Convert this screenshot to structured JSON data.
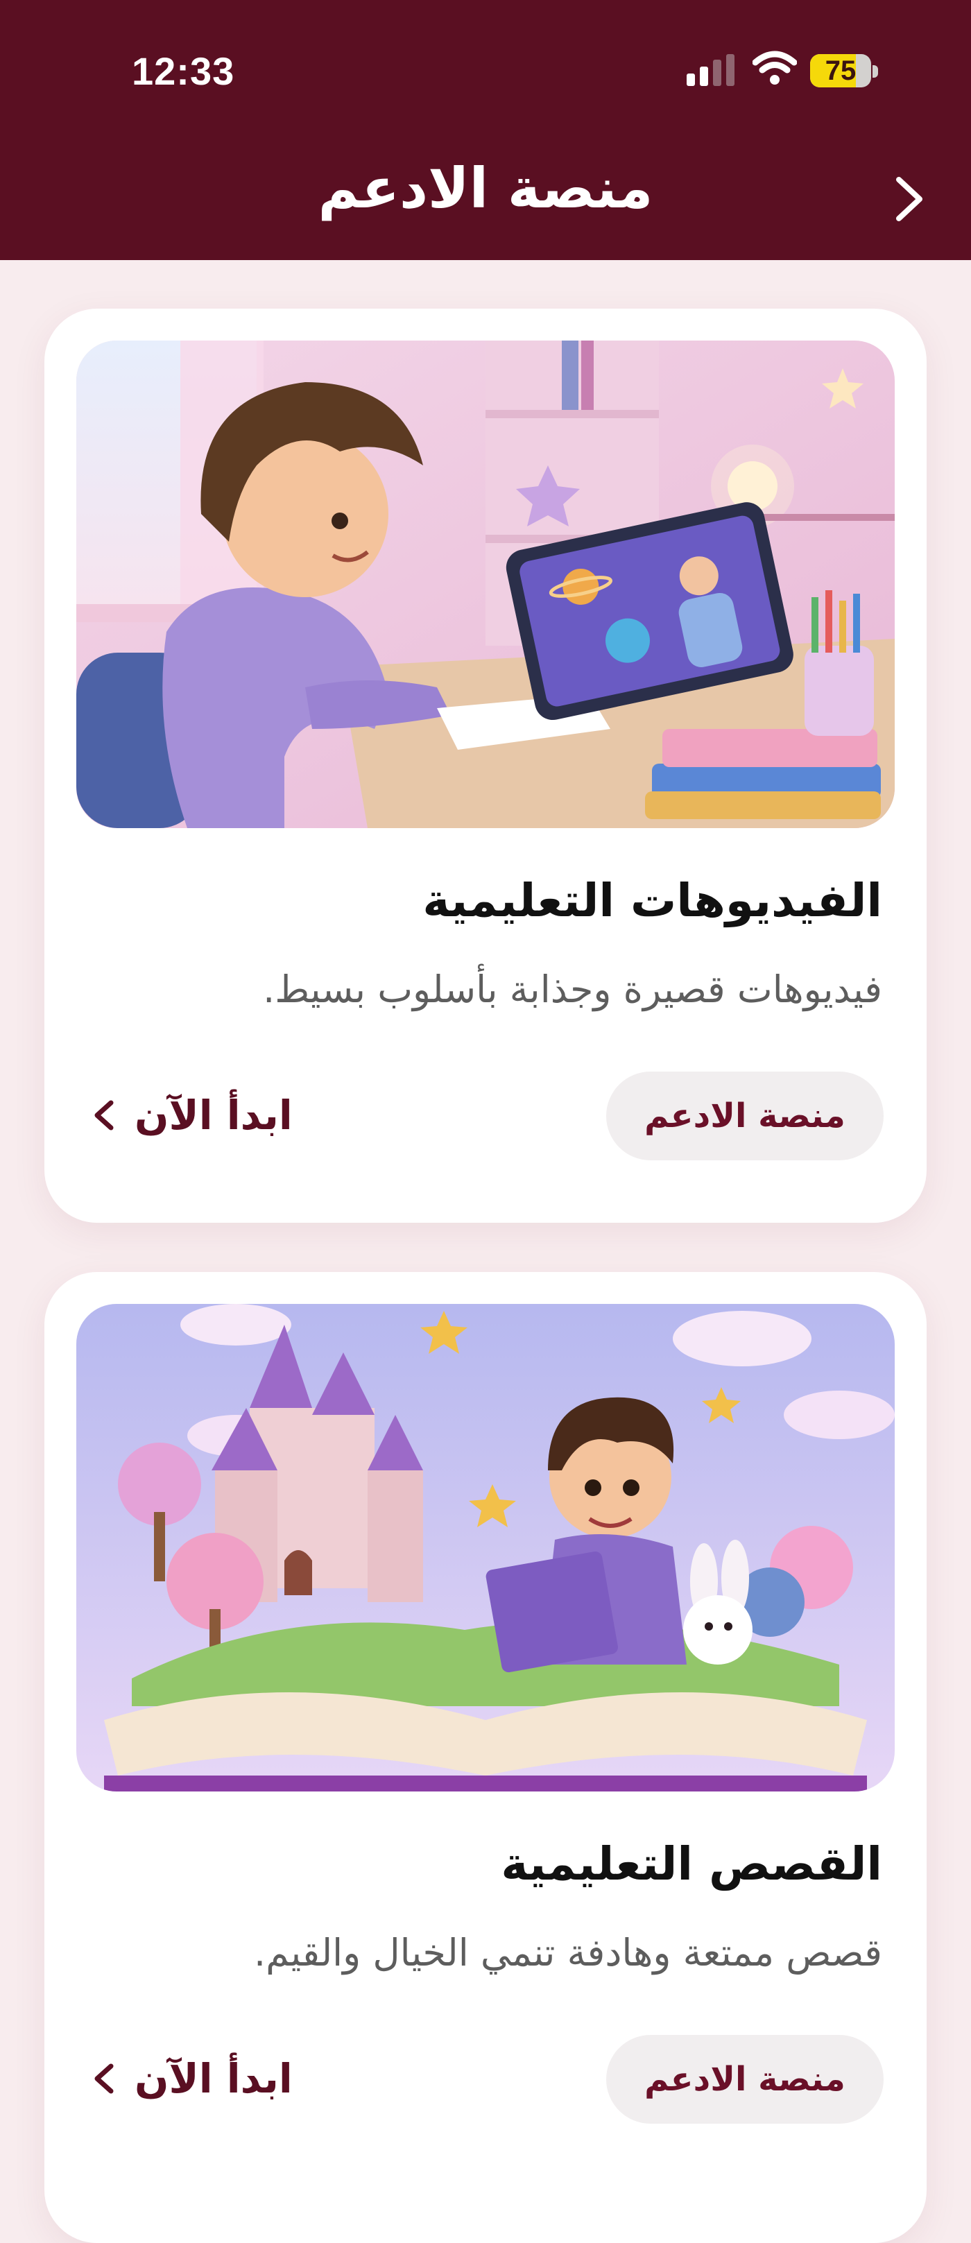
{
  "status_bar": {
    "time": "12:33",
    "battery_level": "75",
    "signal_icon": "cellular-signal-icon",
    "wifi_icon": "wifi-icon"
  },
  "header": {
    "title": "منصة الادعم",
    "back_icon": "chevron-right-icon"
  },
  "cards": [
    {
      "image_subject": "child-learning-with-tablet-illustration",
      "title": "الفيديوهات التعليمية",
      "description": "فيديوهات قصيرة وجذابة بأسلوب بسيط.",
      "badge": "منصة الادعم",
      "action": "ابدأ الآن",
      "action_icon": "chevron-left-icon"
    },
    {
      "image_subject": "child-reading-storybook-castle-illustration",
      "title": "القصص التعليمية",
      "description": "قصص ممتعة وهادفة تنمي الخيال والقيم.",
      "badge": "منصة الادعم",
      "action": "ابدأ الآن",
      "action_icon": "chevron-left-icon"
    }
  ],
  "colors": {
    "header_background": "#5a0f22",
    "page_background": "#f8ecee",
    "accent": "#6a1028",
    "battery": "#f5d90a"
  }
}
